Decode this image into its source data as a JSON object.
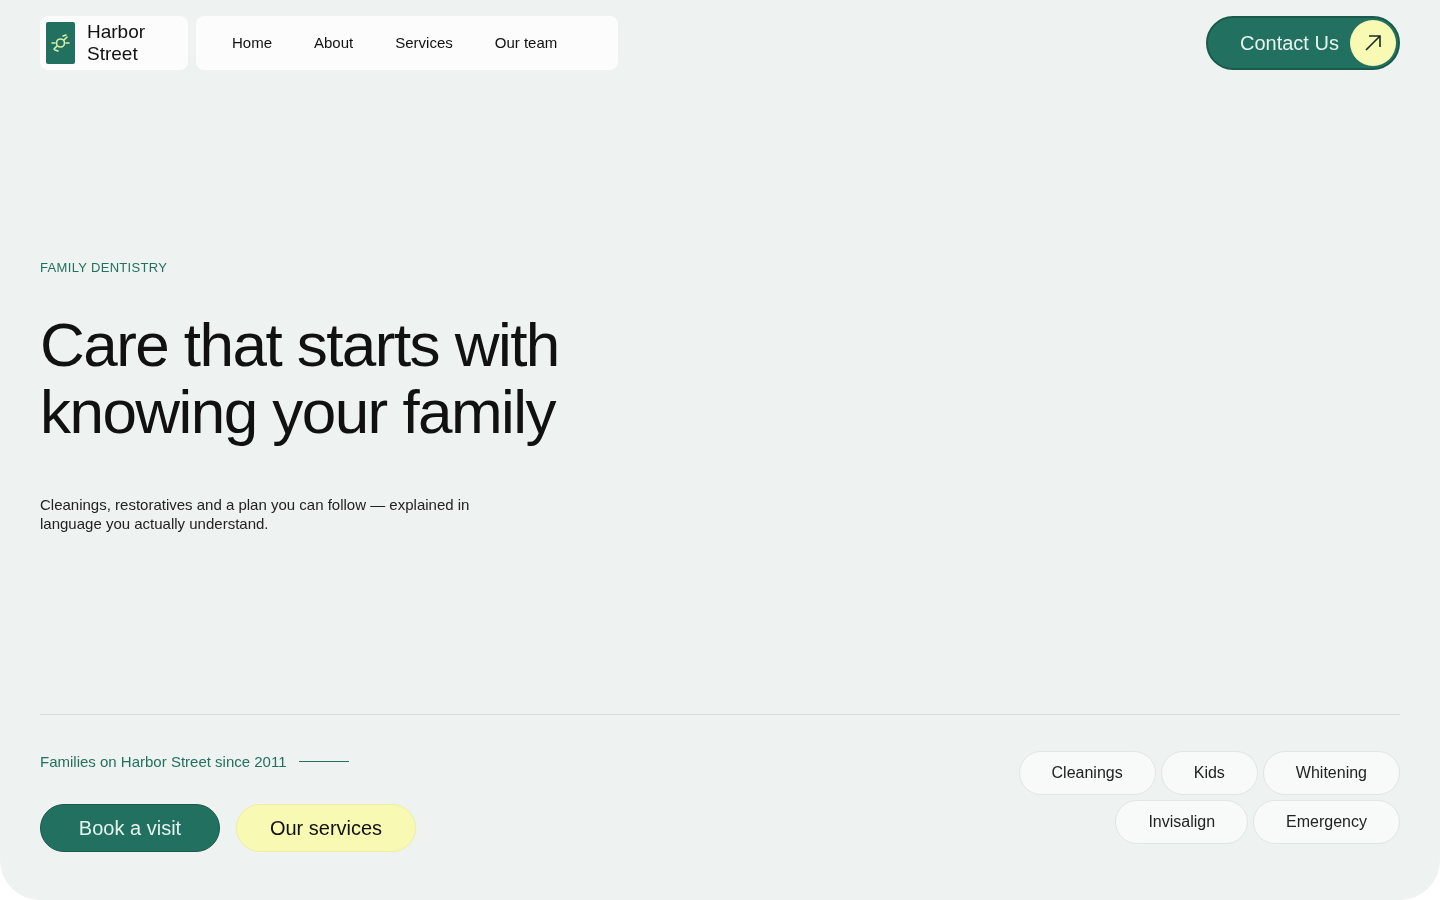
{
  "brand": {
    "name_line_1": "Harbor",
    "name_line_2": "Street"
  },
  "nav": [
    {
      "label": "Home"
    },
    {
      "label": "About"
    },
    {
      "label": "Services"
    },
    {
      "label": "Our team"
    }
  ],
  "contact_button": {
    "label": "Contact Us"
  },
  "hero": {
    "eyebrow": "FAMILY DENTISTRY",
    "title_line_1": "Care that starts with",
    "title_line_2": "knowing your family",
    "lead": "Cleanings, restoratives and a plan you can follow — explained in language you actually understand."
  },
  "tagline": "Families on Harbor Street since 2011",
  "actions": [
    {
      "label": "Book a visit",
      "kind": "primary"
    },
    {
      "label": "Our services",
      "kind": "secondary"
    }
  ],
  "service_tags": [
    [
      "Cleanings",
      "Kids",
      "Whitening"
    ],
    [
      "Invisalign",
      "Emergency"
    ]
  ]
}
